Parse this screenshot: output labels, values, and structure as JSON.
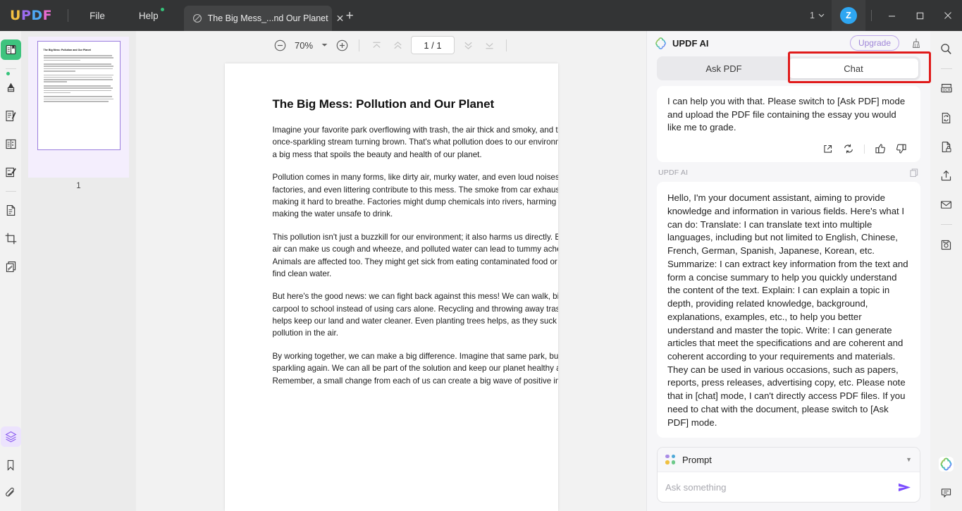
{
  "titlebar": {
    "logo_parts": [
      "U",
      "P",
      "D",
      "F"
    ],
    "menus": [
      {
        "label": "File",
        "name": "menu-file"
      },
      {
        "label": "Help",
        "name": "menu-help"
      }
    ],
    "tab": {
      "title": "The Big Mess_...nd Our Planet",
      "close_label": "✕"
    },
    "new_tab_label": "+",
    "window_count": "1",
    "avatar_initial": "Z",
    "minimize_label": "—",
    "maximize_label": "□",
    "close_label": "✕"
  },
  "left_rail": {
    "items": [
      {
        "name": "sidebar-reader-icon",
        "title": "Reader",
        "state": "active-green"
      },
      {
        "name": "sidebar-annotate-icon",
        "title": "Comment"
      },
      {
        "name": "sidebar-edit-pdf-icon",
        "title": "Edit PDF"
      },
      {
        "name": "sidebar-form-icon",
        "title": "Form"
      },
      {
        "name": "sidebar-sign-icon",
        "title": "Sign"
      },
      {
        "name": "sidebar-page-icon",
        "title": "Page"
      },
      {
        "name": "sidebar-crop-icon",
        "title": "Crop"
      },
      {
        "name": "sidebar-organize-icon",
        "title": "Organize Pages"
      }
    ],
    "bottom_items": [
      {
        "name": "sidebar-layers-icon",
        "title": "Layers",
        "state": "active-purple"
      },
      {
        "name": "sidebar-bookmark-icon",
        "title": "Bookmark"
      },
      {
        "name": "sidebar-attachment-icon",
        "title": "Attachment"
      }
    ]
  },
  "thumbnails": {
    "page_number": "1",
    "preview_title": "The Big Mess: Pollution and Our Planet"
  },
  "toolbar": {
    "zoom_out_title": "Zoom out",
    "zoom_value": "70%",
    "zoom_in_title": "Zoom in",
    "first_page_title": "First page",
    "prev_page_title": "Previous page",
    "page_indicator": "1 / 1",
    "next_page_title": "Next page",
    "last_page_title": "Last page"
  },
  "document": {
    "title": "The Big Mess: Pollution and Our Planet",
    "paragraphs": [
      [
        "Imagine your favorite park overflowing with trash, the air thick and smoky, and the",
        "once-sparkling stream turning brown. That's what pollution does to our environment. It's like",
        "a big mess that spoils the beauty and health of our planet."
      ],
      [
        "Pollution comes in many forms, like dirty air, murky water, and even loud noises. Cars,",
        "factories, and even littering contribute to this mess. The smoke from car exhaust fills the air,",
        "making it hard to breathe. Factories might dump chemicals into rivers, harming the fish and",
        "making the water unsafe to drink."
      ],
      [
        "This pollution isn't just a buzzkill for our environment; it also harms us directly. Breathing dirty",
        "air can make us cough and wheeze, and polluted water can lead to tummy aches and worse.",
        "Animals are affected too. They might get sick from eating contaminated food or struggle to",
        "find clean water."
      ],
      [
        "But here's the good news: we can fight back against this mess! We can walk, bike, or",
        "carpool to school instead of using cars alone. Recycling and throwing away trash properly",
        "helps keep our land and water cleaner. Even planting trees helps, as they suck up the",
        "pollution in the air."
      ],
      [
        "By working together, we can make a big difference. Imagine that same park, but clean and",
        "sparkling again. We can all be part of the solution and keep our planet healthy and beautiful.",
        "Remember, a small change from each of us can create a big wave of positive impact!"
      ]
    ]
  },
  "ai_panel": {
    "title": "UPDF AI",
    "upgrade_label": "Upgrade",
    "clear_title": "Clear chat",
    "tabs": [
      {
        "label": "Ask PDF",
        "name": "tab-ask-pdf",
        "active": false
      },
      {
        "label": "Chat",
        "name": "tab-chat",
        "active": true
      }
    ],
    "highlight_color": "#e01b1b",
    "messages": [
      {
        "role": "assistant",
        "text": "I can help you with that. Please switch to [Ask PDF] mode and upload the PDF file containing the essay you would like me to grade.",
        "actions": [
          "share-icon",
          "regenerate-icon",
          "thumbs-up-icon",
          "thumbs-down-icon"
        ]
      },
      {
        "role": "assistant",
        "label": "UPDF AI",
        "text": "Hello, I'm your document assistant, aiming to provide knowledge and information in various fields. Here's what I can do:\nTranslate: I can translate text into multiple languages, including but not limited to English, Chinese, French, German, Spanish, Japanese, Korean, etc.\nSummarize: I can extract key information from the text and form a concise summary to help you quickly understand the content of the text.\nExplain: I can explain a topic in depth, providing related knowledge, background, explanations, examples, etc., to help you better understand and master the topic.\nWrite: I can generate articles that meet the specifications and are coherent and coherent according to your requirements and materials. They can be used in various occasions, such as papers, reports, press releases, advertising copy, etc.\nPlease note that in [chat] mode, I can't directly access PDF files. If you need to chat with the document, please switch to [Ask PDF] mode."
      }
    ],
    "composer": {
      "prompt_label": "Prompt",
      "prompt_caret": "▼",
      "input_placeholder": "Ask something",
      "input_value": "",
      "send_title": "Send"
    }
  },
  "right_rail": {
    "items": [
      {
        "name": "search-icon",
        "title": "Search"
      },
      {
        "name": "ocr-icon",
        "title": "OCR"
      },
      {
        "name": "convert-icon",
        "title": "Convert PDF"
      },
      {
        "name": "protect-icon",
        "title": "Protect"
      },
      {
        "name": "share-export-icon",
        "title": "Share"
      },
      {
        "name": "email-icon",
        "title": "Email"
      },
      {
        "name": "save-icon",
        "title": "Save"
      }
    ],
    "bottom_items": [
      {
        "name": "updf-ai-icon",
        "title": "UPDF AI"
      },
      {
        "name": "comment-icon",
        "title": "Comment"
      }
    ]
  },
  "colors": {
    "titlebar_bg": "#333435",
    "accent_green": "#3ec37e",
    "accent_purple": "#9b7ede",
    "avatar_blue": "#2ea6f2",
    "dot_purple": "#a98ce6",
    "dot_blue": "#4fa9d8",
    "dot_yellow": "#f0c040",
    "dot_green": "#6dc98a",
    "send_purple": "#7c4dff"
  }
}
